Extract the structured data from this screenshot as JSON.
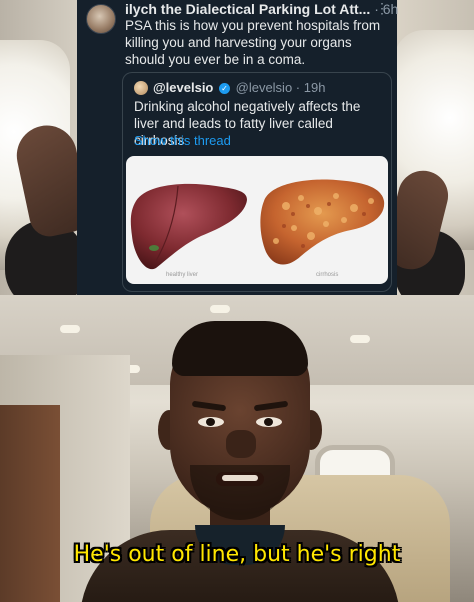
{
  "tweet": {
    "author": "ilych the Dialectical Parking Lot Att...",
    "time": "· 6h",
    "more": "⋮",
    "text": "PSA this is how you prevent hospitals from killing you and harvesting your organs should you ever be in a coma."
  },
  "quote": {
    "name": "@levelsio",
    "verified": "✓",
    "handle_time": "@levelsio · 19h",
    "text": "Drinking alcohol negatively affects the liver and leads to fatty liver called cirrhosis",
    "show_thread": "Show this thread",
    "image_captions": {
      "healthy": "healthy liver",
      "cirrhosis": "cirrhosis"
    }
  },
  "caption": "He's out of line, but he's right",
  "colors": {
    "twitter_bg": "#15202b",
    "link_blue": "#1d9bf0",
    "caption_yellow": "#ffe600"
  }
}
